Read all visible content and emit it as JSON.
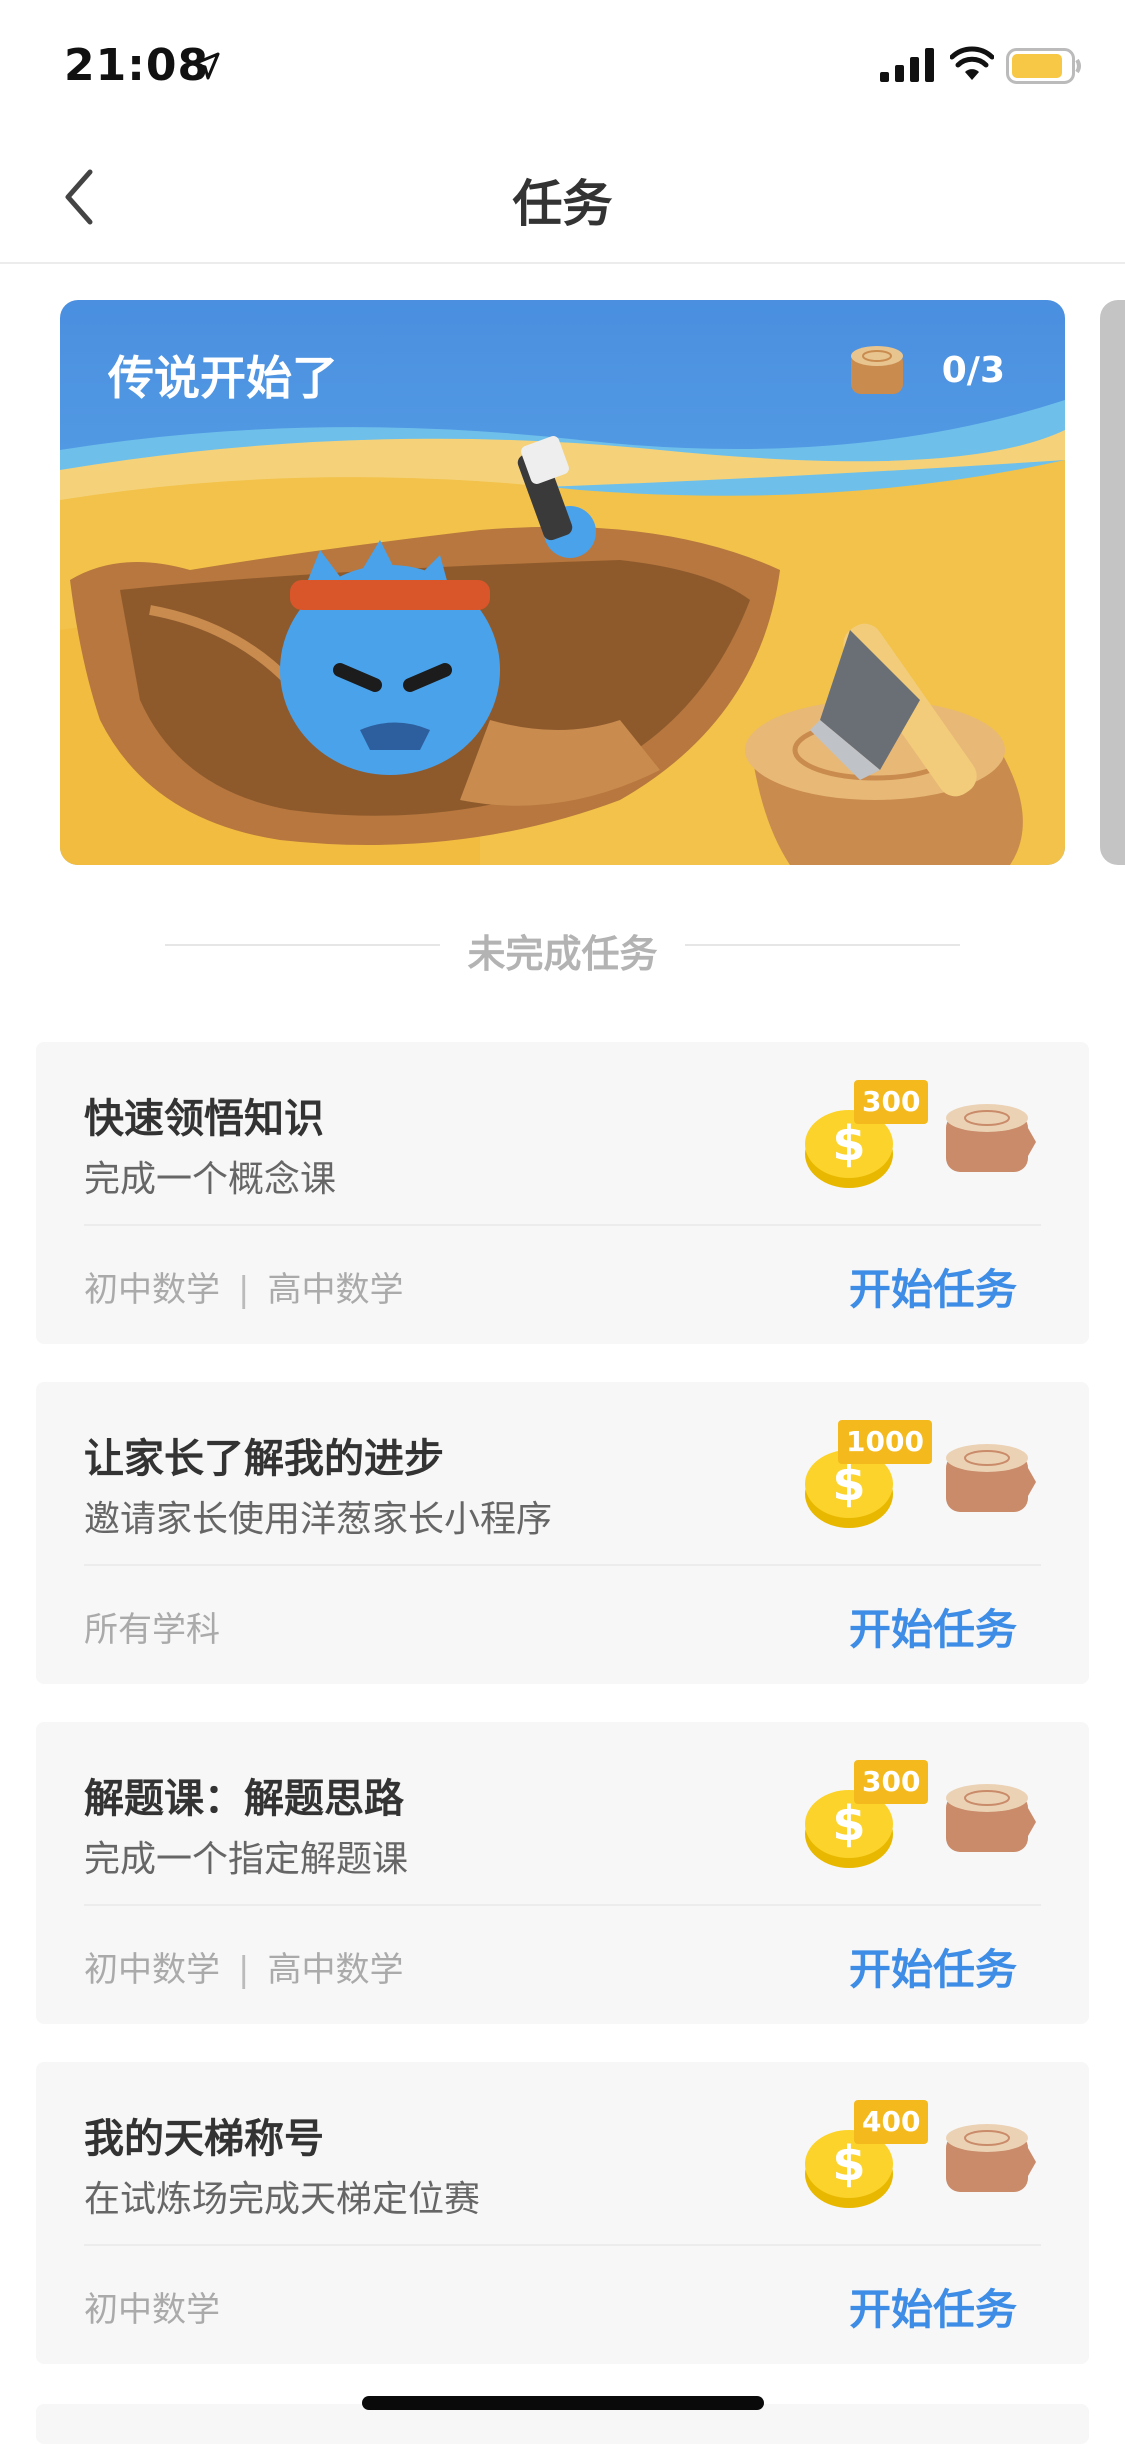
{
  "status": {
    "time": "21:08"
  },
  "nav": {
    "title": "任务"
  },
  "banner": {
    "title": "传说开始了",
    "progress": "0/3"
  },
  "section": {
    "label": "未完成任务"
  },
  "tasks": [
    {
      "title": "快速领悟知识",
      "desc": "完成一个概念课",
      "tags": [
        "初中数学",
        "高中数学"
      ],
      "reward": "300",
      "action": "开始任务"
    },
    {
      "title": "让家长了解我的进步",
      "desc": "邀请家长使用洋葱家长小程序",
      "tags": [
        "所有学科"
      ],
      "reward": "1000",
      "action": "开始任务"
    },
    {
      "title": "解题课：解题思路",
      "desc": "完成一个指定解题课",
      "tags": [
        "初中数学",
        "高中数学"
      ],
      "reward": "300",
      "action": "开始任务"
    },
    {
      "title": "我的天梯称号",
      "desc": "在试炼场完成天梯定位赛",
      "tags": [
        "初中数学"
      ],
      "reward": "400",
      "action": "开始任务"
    }
  ],
  "colors": {
    "accent": "#3d8ce6",
    "coin_badge": "#f4b91c",
    "banner_sky": "#4a90e2",
    "banner_sand": "#f2c24a"
  }
}
